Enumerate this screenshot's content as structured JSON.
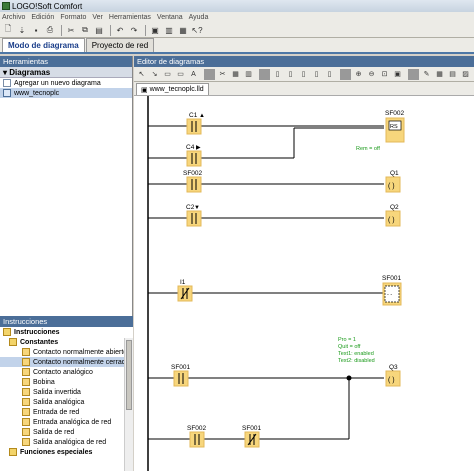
{
  "window": {
    "title": "LOGO!Soft Comfort"
  },
  "menu": [
    "Archivo",
    "Edición",
    "Formato",
    "Ver",
    "Herramientas",
    "Ventana",
    "Ayuda"
  ],
  "mode_tabs": {
    "diagram": "Modo de diagrama",
    "network": "Proyecto de red"
  },
  "tools_panel": {
    "header": "Herramientas",
    "diagrams_title": "Diagramas",
    "diagram_items": [
      {
        "label": "Agregar un nuevo diagrama"
      },
      {
        "label": "www_tecnoplc"
      }
    ]
  },
  "instructions_panel": {
    "header": "Instrucciones",
    "root": "Instrucciones",
    "constants": "Constantes",
    "items": [
      "Contacto normalmente abierto",
      "Contacto normalmente cerrado",
      "Contacto analógico",
      "Bobina",
      "Salida invertida",
      "Salida analógica",
      "Entrada de red",
      "Entrada analógica de red",
      "Salida de red",
      "Salida analógica de red"
    ],
    "special": "Funciones especiales"
  },
  "editor": {
    "header": "Editor de diagramas",
    "doc_tab": "www_tecnoplc.lld"
  },
  "ladder": {
    "contacts": [
      {
        "label": "C1",
        "arrow": "▲"
      },
      {
        "label": "C4",
        "arrow": "▶"
      },
      {
        "label": "SF002",
        "arrow": ""
      },
      {
        "label": "C2",
        "arrow": "▼"
      },
      {
        "label": "I1",
        "arrow": ""
      },
      {
        "label": "SF001",
        "arrow": ""
      },
      {
        "label": "SF002",
        "arrow": ""
      },
      {
        "label": "SF001",
        "arrow": ""
      }
    ],
    "coils": [
      {
        "label": "SF002",
        "text": "RS"
      },
      {
        "label": "Q1",
        "text": "( )"
      },
      {
        "label": "Q2",
        "text": "( )"
      },
      {
        "label": "SF001",
        "text": "- -"
      },
      {
        "label": "Q3",
        "text": "( )"
      }
    ],
    "params_rs": [
      "Rem = off"
    ],
    "params_sf001": [
      "Pro = 1",
      "Quit = off",
      "Text1: enabled",
      "Text2: disabled"
    ]
  },
  "colors": {
    "accent": "#4b6e98",
    "element": "#f7d67c",
    "param_text": "#1a9a1a"
  }
}
